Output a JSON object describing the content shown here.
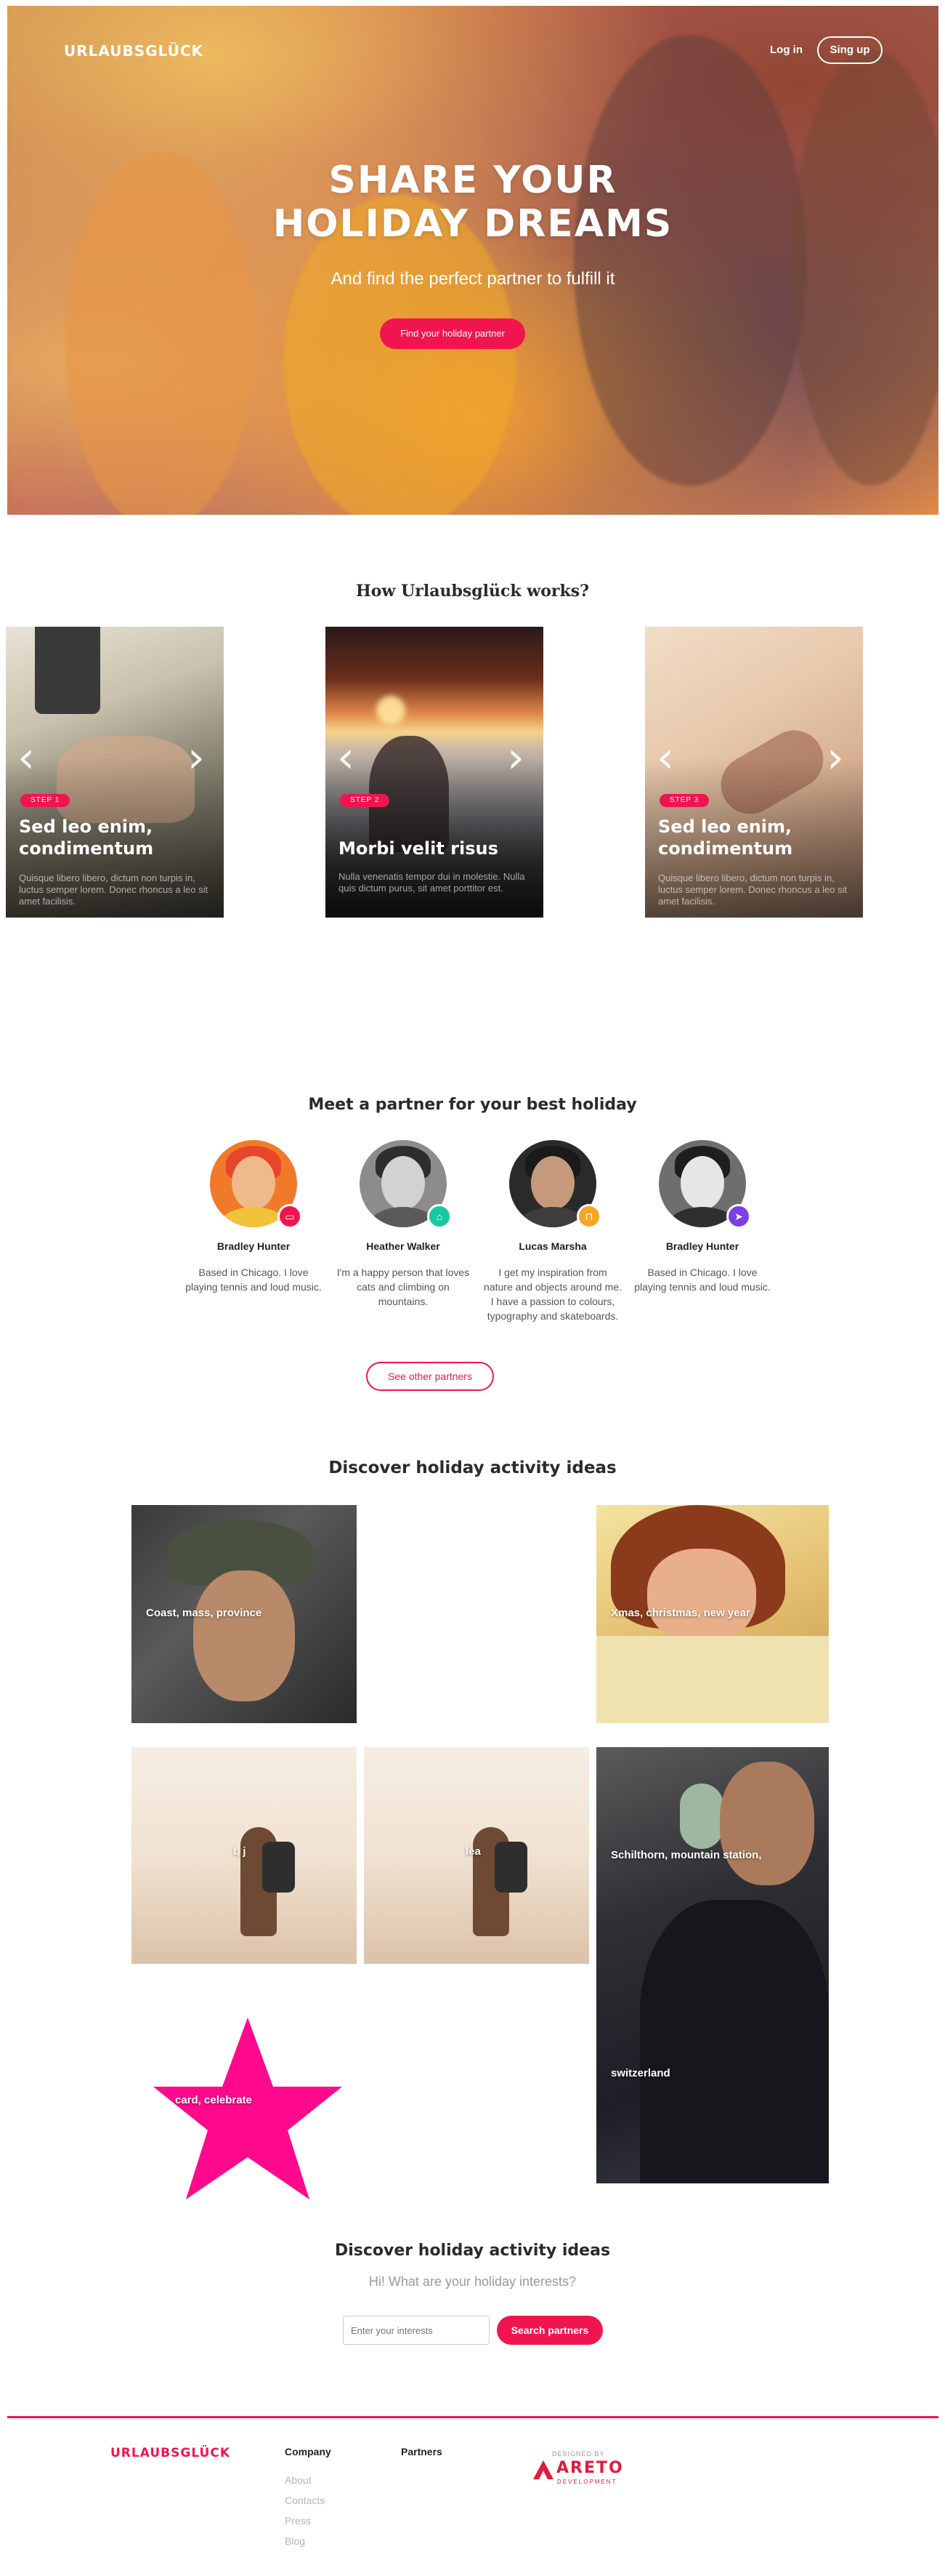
{
  "header": {
    "brand": "URLAUBSGLÜCK",
    "login_label": "Log in",
    "signup_label": "Sing up"
  },
  "hero": {
    "title_line1": "SHARE YOUR",
    "title_line2": "HOLIDAY DREAMS",
    "subtitle": "And find the perfect partner to fulfill it",
    "cta_label": "Find your holiday partner"
  },
  "how": {
    "title": "How Urlaubsglück works?",
    "steps": [
      {
        "badge": "STEP 1",
        "title": "Sed leo enim, condimentum",
        "text": "Quisque libero libero, dictum non turpis in, luctus semper lorem. Donec rhoncus a leo sit amet facilisis."
      },
      {
        "badge": "STEP 2",
        "title": "Morbi velit risus",
        "text": "Nulla venenatis tempor dui in molestie. Nulla quis dictum purus, sit amet porttitor est."
      },
      {
        "badge": "STEP 3",
        "title": "Sed leo enim, condimentum",
        "text": "Quisque libero libero, dictum non turpis in, luctus semper lorem. Donec rhoncus a leo sit amet facilisis."
      }
    ]
  },
  "partners": {
    "title": "Meet a partner for your best holiday",
    "items": [
      {
        "name": "Bradley Hunter",
        "desc": "Based in Chicago. I love playing tennis and loud music.",
        "badge_icon": "tv-icon",
        "badge_color": "#f1154f"
      },
      {
        "name": "Heather Walker",
        "desc": "I'm a happy person that loves cats and climbing on mountains.",
        "badge_icon": "home-icon",
        "badge_color": "#19c7a1"
      },
      {
        "name": "Lucas Marsha",
        "desc": "I get my inspiration from nature and objects around me. I have a passion to colours, typography and skateboards.",
        "badge_icon": "lock-icon",
        "badge_color": "#f5a623"
      },
      {
        "name": "Bradley Hunter",
        "desc": "Based in Chicago. I love playing tennis and loud music.",
        "badge_icon": "send-icon",
        "badge_color": "#7b3fe4"
      }
    ],
    "see_other_label": "See other partners"
  },
  "discover": {
    "title": "Discover holiday activity ideas",
    "tiles": [
      {
        "label": "Coast, mass, province"
      },
      {
        "label": "Xmas, christmas, new year"
      },
      {
        "label": "t, j"
      },
      {
        "label": "lea"
      },
      {
        "label": "Schilthorn, mountain station,"
      },
      {
        "label": "switzerland"
      },
      {
        "label": "card, celebrate"
      }
    ]
  },
  "search": {
    "title": "Discover holiday activity ideas",
    "subtitle": "Hi! What are your holiday interests?",
    "placeholder": "Enter your interests",
    "button_label": "Search partners"
  },
  "footer": {
    "brand": "URLAUBSGLÜCK",
    "company_head": "Company",
    "company_links": [
      "About",
      "Contacts",
      "Press",
      "Blog"
    ],
    "partners_head": "Partners",
    "designed_by": "DESIGNED BY",
    "designer_name": "ARETO",
    "designer_sub": "DEVELOPMENT"
  },
  "colors": {
    "accent": "#f1154f",
    "star": "#ff0a8c"
  }
}
